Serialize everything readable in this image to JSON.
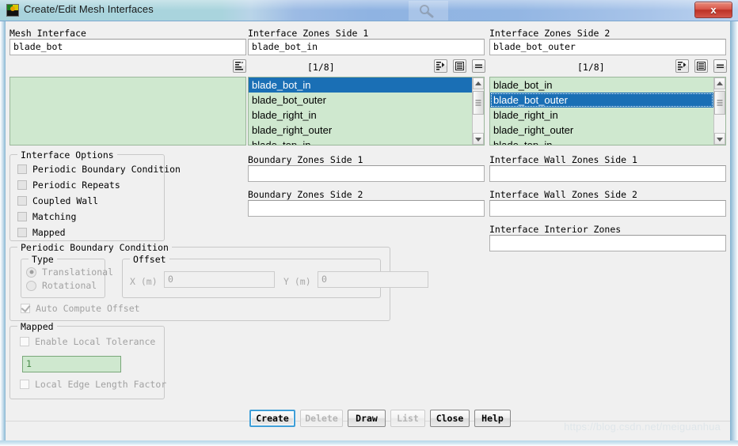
{
  "window": {
    "title": "Create/Edit Mesh Interfaces",
    "close_label": "x",
    "icon": "fluent-app-icon",
    "ghost_icon": "search-icon"
  },
  "top": {
    "mesh_interface_label": "Mesh Interface",
    "mesh_interface_value": "blade_bot",
    "zones_side1_label": "Interface Zones Side 1",
    "zones_side1_value": "blade_bot_in",
    "zones_side2_label": "Interface Zones Side 2",
    "zones_side2_value": "blade_bot_outer"
  },
  "toolbars": {
    "left_filter_icon": "filter-list-icon",
    "side1_page": "[1/8]",
    "side2_page": "[1/8]",
    "icons": {
      "filter": "filter-list-icon",
      "list": "list-lines-icon",
      "collapse": "equals-icon"
    }
  },
  "lists": {
    "left_items": [],
    "side1": {
      "items": [
        "blade_bot_in",
        "blade_bot_outer",
        "blade_right_in",
        "blade_right_outer",
        "blade_top_in"
      ],
      "selected_index": 0
    },
    "side2": {
      "items": [
        "blade_bot_in",
        "blade_bot_outer",
        "blade_right_in",
        "blade_right_outer",
        "blade_top_in"
      ],
      "selected_index": 1
    }
  },
  "interface_options": {
    "title": "Interface Options",
    "items": [
      {
        "label": "Periodic Boundary Condition",
        "checked": false
      },
      {
        "label": "Periodic Repeats",
        "checked": false
      },
      {
        "label": "Coupled Wall",
        "checked": false
      },
      {
        "label": "Matching",
        "checked": false
      },
      {
        "label": "Mapped",
        "checked": false
      }
    ]
  },
  "boundary_zones": {
    "side1_label": "Boundary Zones Side 1",
    "side1_value": "",
    "side2_label": "Boundary Zones Side 2",
    "side2_value": ""
  },
  "interface_wall_zones": {
    "side1_label": "Interface Wall Zones Side 1",
    "side1_value": "",
    "side2_label": "Interface Wall Zones Side 2",
    "side2_value": "",
    "interior_label": "Interface Interior Zones",
    "interior_value": ""
  },
  "periodic_bc": {
    "title": "Periodic Boundary Condition",
    "type_title": "Type",
    "type_options": [
      {
        "label": "Translational",
        "selected": true
      },
      {
        "label": "Rotational",
        "selected": false
      }
    ],
    "offset_title": "Offset",
    "x_label": "X  (m)",
    "x_value": "0",
    "y_label": "Y  (m)",
    "y_value": "0",
    "auto_compute_label": "Auto Compute Offset",
    "auto_compute_checked": true
  },
  "mapped": {
    "title": "Mapped",
    "enable_local_tolerance_label": "Enable Local Tolerance",
    "enable_local_tolerance_checked": false,
    "tolerance_value": "1",
    "local_edge_length_label": "Local Edge Length Factor",
    "local_edge_length_checked": false
  },
  "buttons": [
    {
      "label": "Create",
      "state": "focused"
    },
    {
      "label": "Delete",
      "state": "disabled"
    },
    {
      "label": "Draw",
      "state": "normal"
    },
    {
      "label": "List",
      "state": "disabled"
    },
    {
      "label": "Close",
      "state": "normal"
    },
    {
      "label": "Help",
      "state": "normal"
    }
  ],
  "watermark": "https://blog.csdn.net/meiguanhua",
  "colors": {
    "selection": "#1a6fb5",
    "list_background": "#cfe8cf",
    "title_accent": "#8fb3e2",
    "close_button": "#bc3126",
    "focus_ring": "#3f9fd8"
  }
}
